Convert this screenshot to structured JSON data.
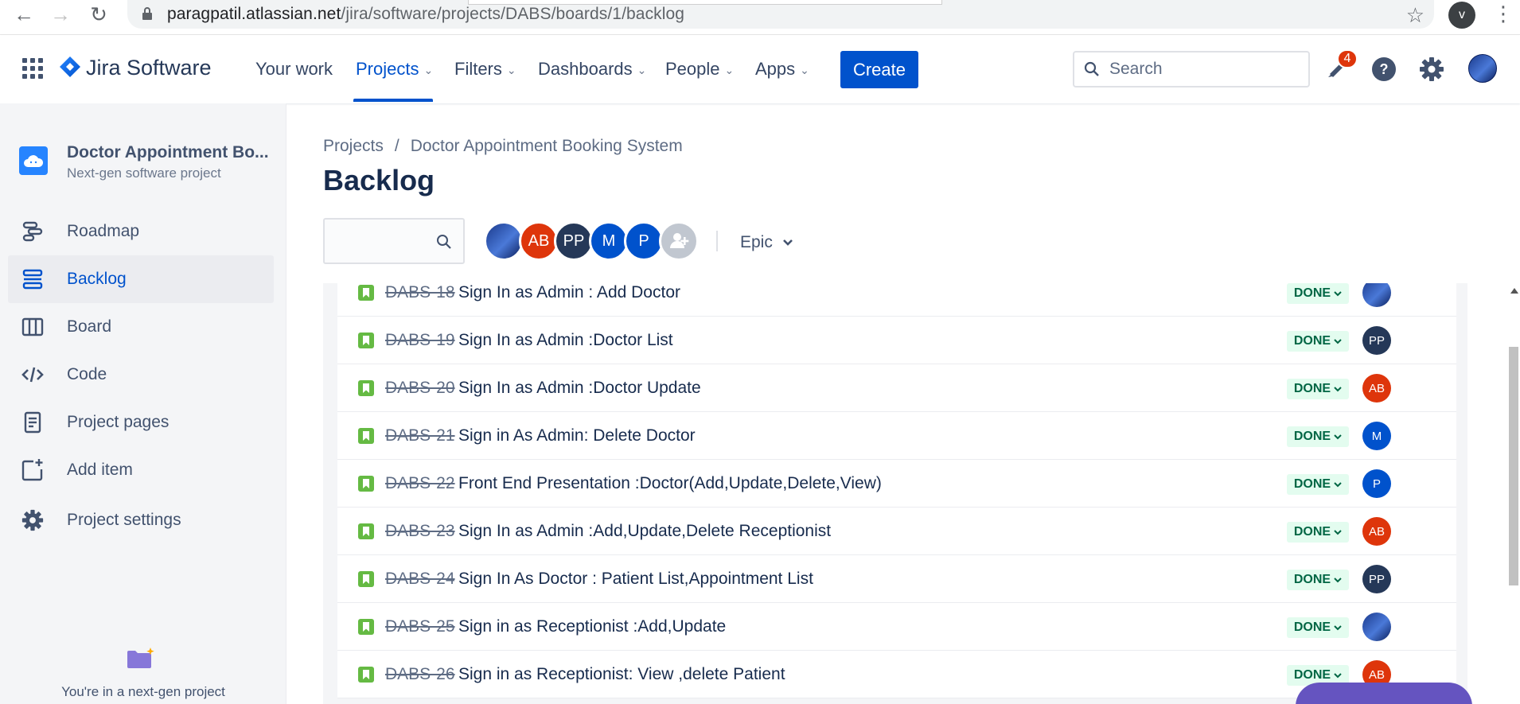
{
  "browser": {
    "url_host": "paragpatil.atlassian.net",
    "url_path": "/jira/software/projects/DABS/boards/1/backlog",
    "profile_initial": "v"
  },
  "topnav": {
    "product": "Jira Software",
    "items": [
      {
        "label": "Your work",
        "has_chevron": false
      },
      {
        "label": "Projects",
        "has_chevron": true,
        "active": true
      },
      {
        "label": "Filters",
        "has_chevron": true
      },
      {
        "label": "Dashboards",
        "has_chevron": true
      },
      {
        "label": "People",
        "has_chevron": true
      },
      {
        "label": "Apps",
        "has_chevron": true
      }
    ],
    "create_label": "Create",
    "search_placeholder": "Search",
    "notifications_count": "4"
  },
  "sidebar": {
    "project_name": "Doctor Appointment Bo...",
    "project_type": "Next-gen software project",
    "items": [
      {
        "label": "Roadmap",
        "icon": "roadmap-icon"
      },
      {
        "label": "Backlog",
        "icon": "backlog-icon",
        "active": true
      },
      {
        "label": "Board",
        "icon": "board-icon"
      },
      {
        "label": "Code",
        "icon": "code-icon"
      },
      {
        "label": "Project pages",
        "icon": "pages-icon"
      },
      {
        "label": "Add item",
        "icon": "add-item-icon"
      },
      {
        "label": "Project settings",
        "icon": "gear-icon"
      }
    ],
    "footer_text": "You're in a next-gen project"
  },
  "main": {
    "breadcrumb": [
      "Projects",
      "Doctor Appointment Booking System"
    ],
    "breadcrumb_separator": "/",
    "title": "Backlog",
    "avatars": [
      {
        "initials": "",
        "color": "#1b3a8c",
        "image": true
      },
      {
        "initials": "AB",
        "color": "#DE350B"
      },
      {
        "initials": "PP",
        "color": "#253858"
      },
      {
        "initials": "M",
        "color": "#0052CC"
      },
      {
        "initials": "P",
        "color": "#0052CC"
      },
      {
        "initials": "",
        "color": "#C1C7D0",
        "add": true
      }
    ],
    "epic_label": "Epic"
  },
  "issues": [
    {
      "key": "DABS-18",
      "summary": "Sign In as Admin : Add Doctor",
      "status": "DONE",
      "assignee": "",
      "assignee_color": "#1b3a8c",
      "image": true
    },
    {
      "key": "DABS-19",
      "summary": "Sign In as Admin :Doctor List",
      "status": "DONE",
      "assignee": "PP",
      "assignee_color": "#253858"
    },
    {
      "key": "DABS-20",
      "summary": "Sign In as Admin :Doctor Update",
      "status": "DONE",
      "assignee": "AB",
      "assignee_color": "#DE350B"
    },
    {
      "key": "DABS-21",
      "summary": "Sign in As Admin: Delete Doctor",
      "status": "DONE",
      "assignee": "M",
      "assignee_color": "#0052CC"
    },
    {
      "key": "DABS-22",
      "summary": "Front End Presentation :Doctor(Add,Update,Delete,View)",
      "status": "DONE",
      "assignee": "P",
      "assignee_color": "#0052CC"
    },
    {
      "key": "DABS-23",
      "summary": "Sign In as Admin :Add,Update,Delete Receptionist",
      "status": "DONE",
      "assignee": "AB",
      "assignee_color": "#DE350B"
    },
    {
      "key": "DABS-24",
      "summary": "Sign In As Doctor : Patient List,Appointment List",
      "status": "DONE",
      "assignee": "PP",
      "assignee_color": "#253858"
    },
    {
      "key": "DABS-25",
      "summary": "Sign in as Receptionist :Add,Update",
      "status": "DONE",
      "assignee": "",
      "assignee_color": "#1b3a8c",
      "image": true
    },
    {
      "key": "DABS-26",
      "summary": "Sign in as Receptionist: View ,delete Patient",
      "status": "DONE",
      "assignee": "AB",
      "assignee_color": "#DE350B"
    }
  ],
  "colors": {
    "accent": "#0052CC",
    "done_bg": "#E3FCEF",
    "done_text": "#006644",
    "story_green": "#65BA43",
    "quickstart": "#6554C0"
  }
}
